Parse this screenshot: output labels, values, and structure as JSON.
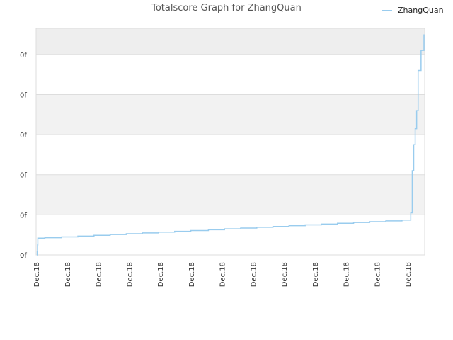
{
  "chart_data": {
    "type": "line",
    "title": "Totalscore Graph for ZhangQuan",
    "xlabel": "",
    "ylabel": "",
    "x_tick_labels": [
      "Dec.18",
      "Dec.18",
      "Dec.18",
      "Dec.18",
      "Dec.18",
      "Dec.18",
      "Dec.18",
      "Dec.18",
      "Dec.18",
      "Dec.18",
      "Dec.18",
      "Dec.18",
      "Dec.18"
    ],
    "y_tick_labels": [
      "0f",
      "0f",
      "0f",
      "0f",
      "0f",
      "0f"
    ],
    "ylim": [
      0,
      5.65
    ],
    "grid": true,
    "legend_position": "top-right",
    "series": [
      {
        "name": "ZhangQuan",
        "color": "#99ccee",
        "x": [
          0,
          0.3,
          0.5,
          0.7,
          5.5,
          17,
          28,
          39,
          50,
          61,
          72,
          83,
          94,
          105,
          117,
          128,
          139,
          150,
          161,
          172,
          183,
          194,
          205,
          216,
          227,
          238,
          249,
          255,
          256,
          257,
          258,
          259,
          260,
          262,
          264
        ],
        "y": [
          0,
          0.08,
          0.25,
          0.42,
          0.43,
          0.45,
          0.47,
          0.49,
          0.51,
          0.53,
          0.55,
          0.57,
          0.59,
          0.61,
          0.63,
          0.65,
          0.67,
          0.69,
          0.71,
          0.73,
          0.75,
          0.77,
          0.79,
          0.81,
          0.83,
          0.85,
          0.87,
          1.05,
          2.1,
          2.75,
          3.15,
          3.6,
          4.6,
          5.1,
          5.5
        ]
      }
    ]
  }
}
